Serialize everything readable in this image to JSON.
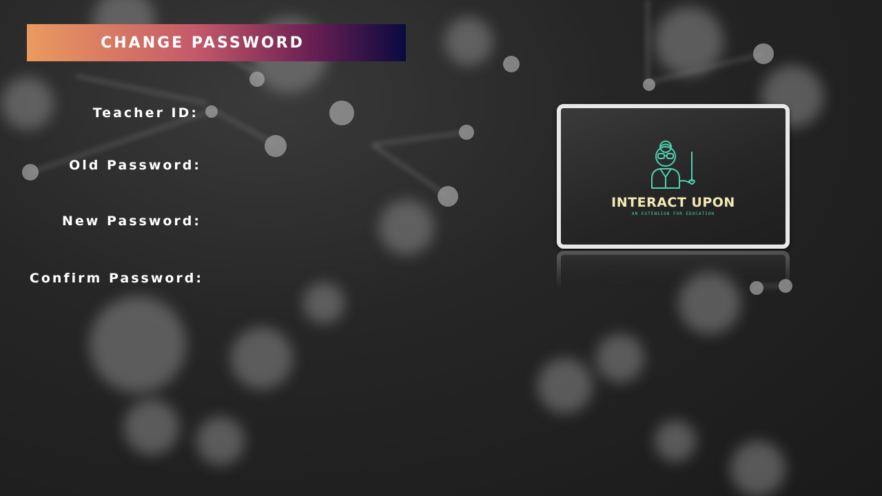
{
  "page": {
    "title": "CHANGE PASSWORD"
  },
  "form": {
    "teacher_id_label": "Teacher ID:",
    "old_password_label": "Old Password:",
    "new_password_label": "New Password:",
    "confirm_password_label": "Confirm Password:",
    "teacher_id_value": "",
    "old_password_value": "",
    "new_password_value": "",
    "confirm_password_value": ""
  },
  "logo": {
    "title": "INTERACT UPON",
    "subtitle": "AN EXTENSION FOR EDUCATION",
    "icon": "teacher-icon"
  },
  "colors": {
    "banner_start": "#eb9a5e",
    "banner_mid": "#c4586a",
    "banner_end": "#0a0a40",
    "logo_title": "#f4e9b3",
    "logo_accent": "#4fd1b0"
  }
}
